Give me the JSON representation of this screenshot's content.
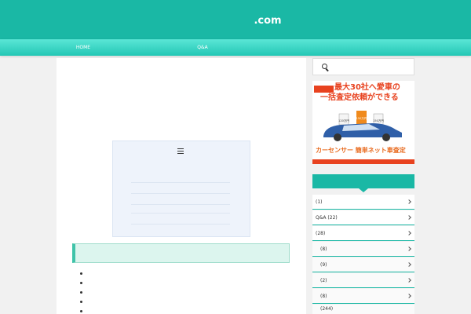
{
  "header": {
    "tagline": "",
    "title_domain": ".com"
  },
  "nav": {
    "items": [
      {
        "label": "HOME"
      },
      {
        "label": ""
      },
      {
        "label": "Q&A"
      },
      {
        "label": ""
      },
      {
        "label": ""
      }
    ]
  },
  "article": {
    "intro_1": "",
    "intro_2": "",
    "intro_3a": "",
    "intro_3b": ""
  },
  "toc": {
    "title": "",
    "toggle": "",
    "items": [
      {
        "label": ""
      },
      {
        "label": ""
      },
      {
        "label": ""
      },
      {
        "label": ""
      },
      {
        "label": ""
      }
    ]
  },
  "section": {
    "heading": "",
    "bullets": [
      {
        "text": ""
      },
      {
        "text": ""
      },
      {
        "text": ""
      },
      {
        "text": ""
      },
      {
        "text": ""
      }
    ]
  },
  "sidebar": {
    "search_icon": "search-icon",
    "ad": {
      "badge": "",
      "line1": "最大30社へ愛車の",
      "line2": "一括査定依頼ができる",
      "prices": [
        "120万円",
        "150万円",
        "150万円"
      ],
      "logo": "カーセンサー 簡単ネット車査定"
    },
    "categories_title": "",
    "categories": [
      {
        "label": "(1)"
      },
      {
        "label": "Q&A (22)"
      },
      {
        "label": "(28)"
      },
      {
        "label": "(8)"
      },
      {
        "label": "(9)"
      },
      {
        "label": "(2)"
      },
      {
        "label": "(8)"
      },
      {
        "label": "(244)"
      }
    ]
  },
  "colors": {
    "brand": "#1ab8a5",
    "nav_light": "#5ae6d6",
    "ad_red": "#e8421f",
    "heading_bg": "#dcf5ee"
  }
}
